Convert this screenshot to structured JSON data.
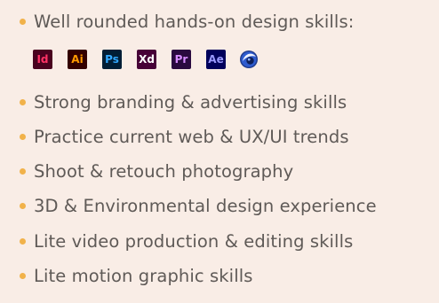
{
  "skills": [
    "Well rounded hands-on design skills:",
    "Strong branding & advertising skills",
    "Practice current web & UX/UI trends",
    "Shoot & retouch photography",
    "3D & Environmental design experience",
    "Lite video production & editing skills",
    "Lite motion graphic skills"
  ],
  "apps": [
    {
      "abbr": "Id",
      "icon": "indesign-icon",
      "bg": "#49021f",
      "fg": "#ff3366"
    },
    {
      "abbr": "Ai",
      "icon": "illustrator-icon",
      "bg": "#330000",
      "fg": "#ff9a00"
    },
    {
      "abbr": "Ps",
      "icon": "photoshop-icon",
      "bg": "#001e36",
      "fg": "#31a8ff"
    },
    {
      "abbr": "Xd",
      "icon": "xd-icon",
      "bg": "#470137",
      "fg": "#ffffff"
    },
    {
      "abbr": "Pr",
      "icon": "premiere-icon",
      "bg": "#2a0a3f",
      "fg": "#d68cff"
    },
    {
      "abbr": "Ae",
      "icon": "after-effects-icon",
      "bg": "#00005b",
      "fg": "#9999ff"
    },
    {
      "abbr": "",
      "icon": "cinema4d-icon",
      "bg": "#1f3a8a",
      "fg": "#ffffff"
    }
  ],
  "colors": {
    "background": "#f9ede6",
    "text": "#5f5a57",
    "bullet": "#f1b24a"
  }
}
